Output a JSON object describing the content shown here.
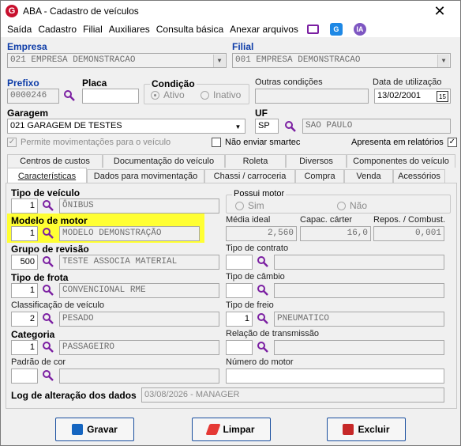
{
  "window": {
    "title": "ABA - Cadastro de veículos",
    "close": "✕"
  },
  "menu": [
    "Saída",
    "Cadastro",
    "Filial",
    "Auxiliares",
    "Consulta básica",
    "Anexar arquivos"
  ],
  "menu_icons": {
    "ia": "IA",
    "g": "G"
  },
  "empresa": {
    "label": "Empresa",
    "value": "021 EMPRESA DEMONSTRACAO"
  },
  "filial": {
    "label": "Filial",
    "value": "001 EMPRESA DEMONSTRACAO"
  },
  "prefixo": {
    "label": "Prefixo",
    "value": "0000246"
  },
  "placa": {
    "label": "Placa",
    "value": ""
  },
  "condicao": {
    "label": "Condição",
    "ativo": "Ativo",
    "inativo": "Inativo"
  },
  "outras": {
    "label": "Outras condições",
    "value": ""
  },
  "data_util": {
    "label": "Data de utilização",
    "value": "13/02/2001",
    "cal": "15"
  },
  "garagem": {
    "label": "Garagem",
    "value": "021 GARAGEM DE TESTES"
  },
  "uf": {
    "label": "UF",
    "code": "SP",
    "name": "SAO PAULO"
  },
  "checks": {
    "perm": "Permite movimentações para o veículo",
    "smartec": "Não enviar smartec",
    "relat": "Apresenta em relatórios",
    "tick": "✓"
  },
  "tabs_row1": [
    "Centros de custos",
    "Documentação do veículo",
    "Roleta",
    "Diversos",
    "Componentes do veículo"
  ],
  "tabs_row2": [
    "Características",
    "Dados para movimentação",
    "Chassi / carroceria",
    "Compra",
    "Venda",
    "Acessórios"
  ],
  "car": {
    "tipo_veiculo": {
      "label": "Tipo de veículo",
      "code": "1",
      "desc": "ÔNIBUS"
    },
    "possui_motor": {
      "label": "Possui motor",
      "sim": "Sim",
      "nao": "Não"
    },
    "modelo_motor": {
      "label": "Modelo de motor",
      "code": "1",
      "desc": "MODELO DEMONSTRAÇÃO"
    },
    "media_ideal": {
      "label": "Média ideal",
      "value": "2,560"
    },
    "capac_carter": {
      "label": "Capac. cárter",
      "value": "16,0"
    },
    "repos": {
      "label": "Repos. / Combust.",
      "value": "0,001"
    },
    "grupo_revisao": {
      "label": "Grupo de revisão",
      "code": "500",
      "desc": "TESTE ASSOCIA MATERIAL"
    },
    "tipo_contrato": {
      "label": "Tipo de contrato",
      "code": "",
      "desc": ""
    },
    "tipo_frota": {
      "label": "Tipo de frota",
      "code": "1",
      "desc": "CONVENCIONAL RME"
    },
    "tipo_cambio": {
      "label": "Tipo de câmbio",
      "code": "",
      "desc": ""
    },
    "classificacao": {
      "label": "Classificação de veículo",
      "code": "2",
      "desc": "PESADO"
    },
    "tipo_freio": {
      "label": "Tipo de freio",
      "code": "1",
      "desc": "PNEUMATICO"
    },
    "categoria": {
      "label": "Categoria",
      "code": "1",
      "desc": "PASSAGEIRO"
    },
    "relacao": {
      "label": "Relação de transmissão",
      "code": "",
      "desc": ""
    },
    "padrao_cor": {
      "label": "Padrão de cor",
      "code": "",
      "desc": ""
    },
    "numero_motor": {
      "label": "Número do motor",
      "value": ""
    },
    "log": {
      "label": "Log de alteração dos dados",
      "value": "03/08/2026 - MANAGER"
    }
  },
  "buttons": {
    "gravar": "Gravar",
    "limpar": "Limpar",
    "excluir": "Excluir"
  },
  "colors": {
    "brand": "#c8102e",
    "highlight": "#ffff33",
    "label_blue": "#0d3ca8",
    "lookup": "#7b1fa2"
  }
}
